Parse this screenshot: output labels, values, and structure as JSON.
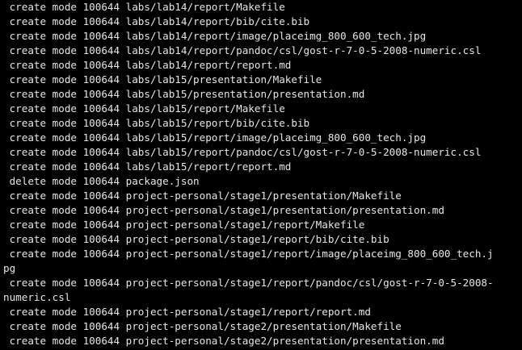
{
  "terminal": {
    "lines": [
      " create mode 100644 labs/lab14/report/Makefile",
      " create mode 100644 labs/lab14/report/bib/cite.bib",
      " create mode 100644 labs/lab14/report/image/placeimg_800_600_tech.jpg",
      " create mode 100644 labs/lab14/report/pandoc/csl/gost-r-7-0-5-2008-numeric.csl",
      " create mode 100644 labs/lab14/report/report.md",
      " create mode 100644 labs/lab15/presentation/Makefile",
      " create mode 100644 labs/lab15/presentation/presentation.md",
      " create mode 100644 labs/lab15/report/Makefile",
      " create mode 100644 labs/lab15/report/bib/cite.bib",
      " create mode 100644 labs/lab15/report/image/placeimg_800_600_tech.jpg",
      " create mode 100644 labs/lab15/report/pandoc/csl/gost-r-7-0-5-2008-numeric.csl",
      " create mode 100644 labs/lab15/report/report.md",
      " delete mode 100644 package.json",
      " create mode 100644 project-personal/stage1/presentation/Makefile",
      " create mode 100644 project-personal/stage1/presentation/presentation.md",
      " create mode 100644 project-personal/stage1/report/Makefile",
      " create mode 100644 project-personal/stage1/report/bib/cite.bib",
      " create mode 100644 project-personal/stage1/report/image/placeimg_800_600_tech.j",
      "pg",
      " create mode 100644 project-personal/stage1/report/pandoc/csl/gost-r-7-0-5-2008-",
      "numeric.csl",
      " create mode 100644 project-personal/stage1/report/report.md",
      " create mode 100644 project-personal/stage2/presentation/Makefile",
      " create mode 100644 project-personal/stage2/presentation/presentation.md"
    ]
  }
}
